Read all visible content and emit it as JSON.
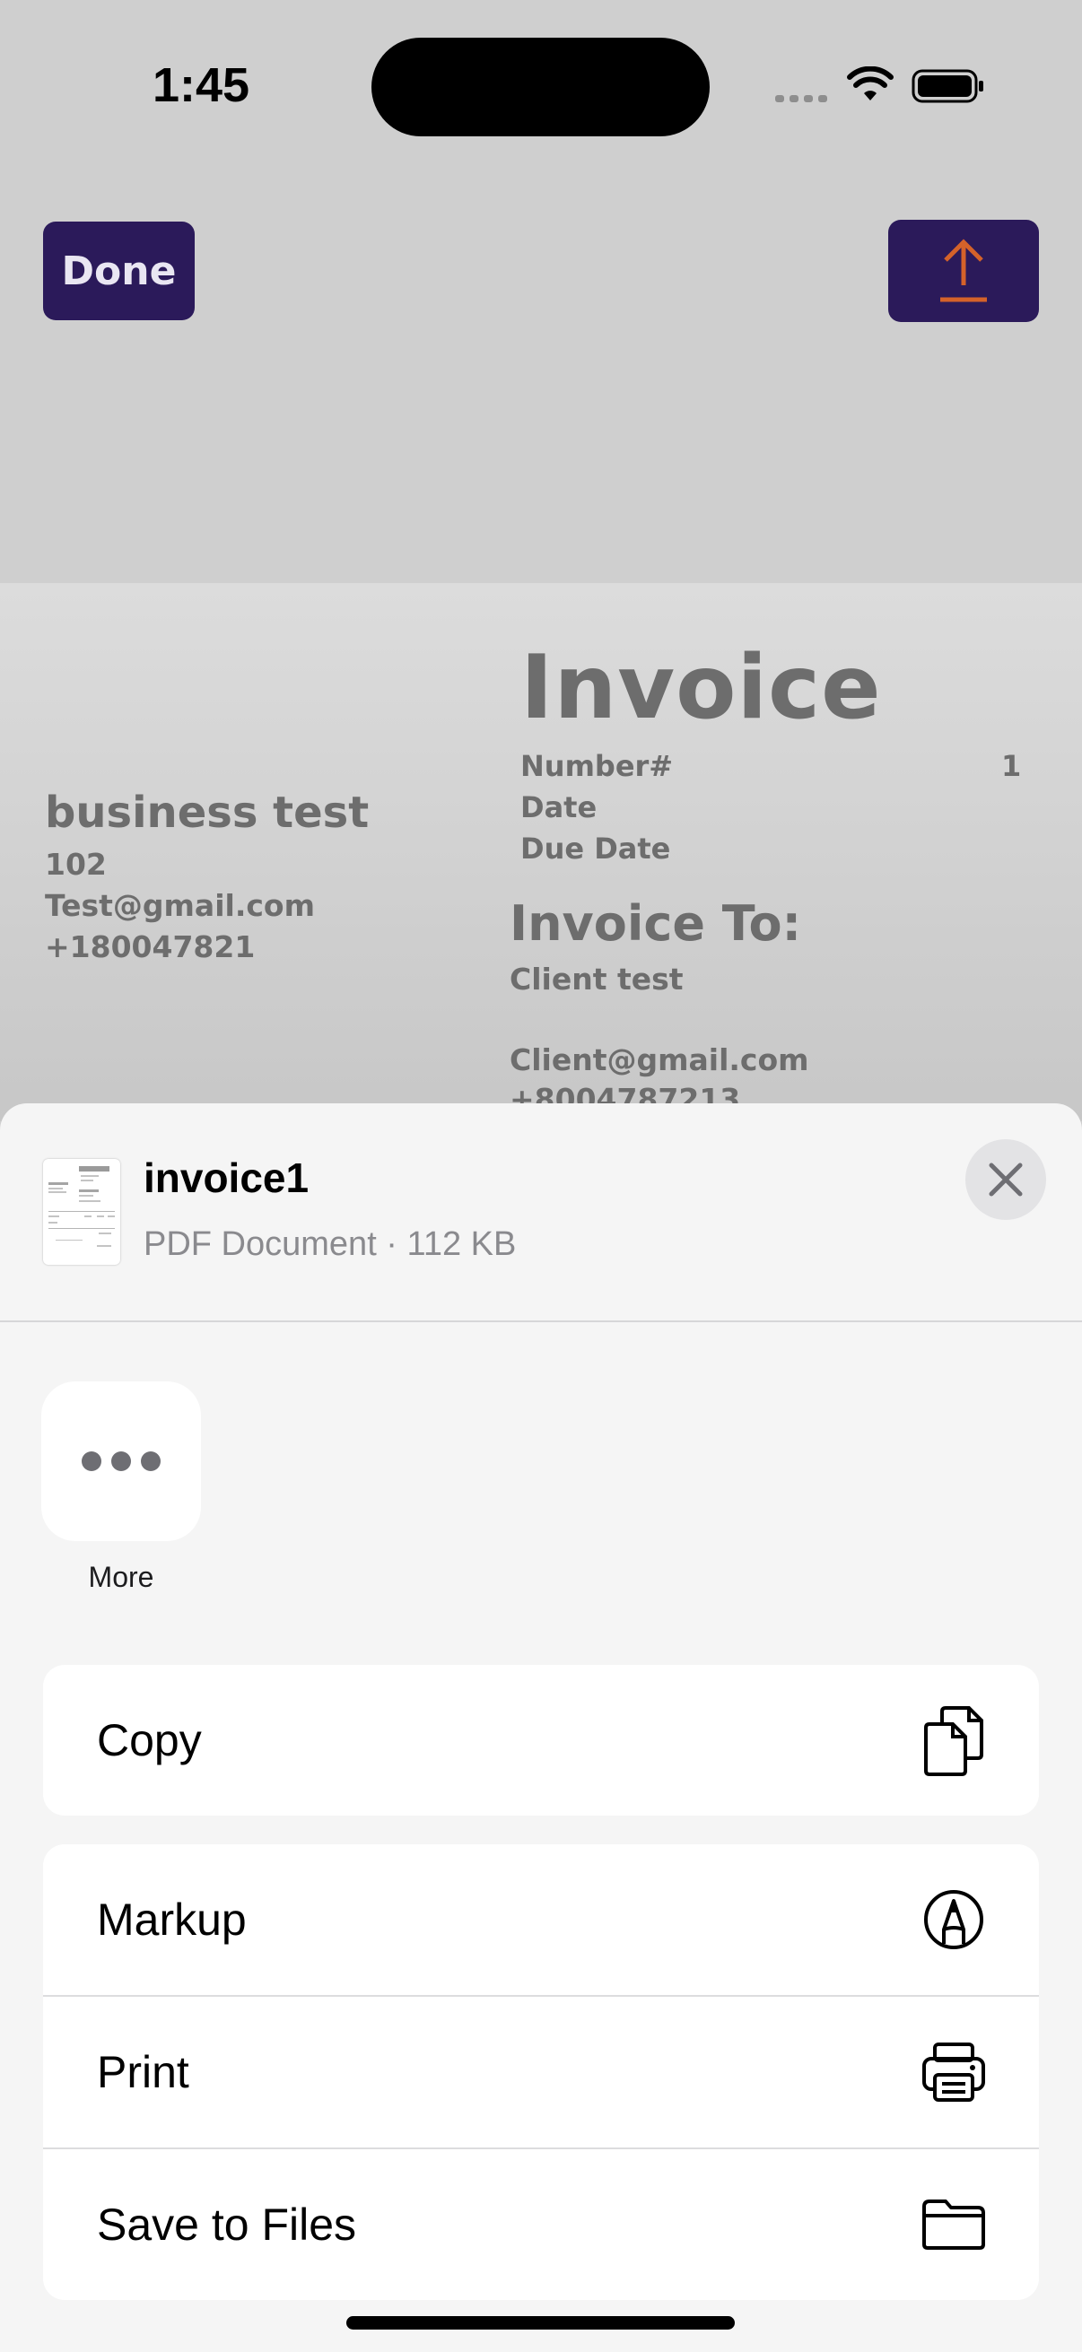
{
  "status_bar": {
    "time": "1:45"
  },
  "toolbar": {
    "done_label": "Done",
    "share_icon": "upload-arrow-icon"
  },
  "invoice": {
    "title": "Invoice",
    "number_label": "Number#",
    "number_value": "1",
    "date_label": "Date",
    "due_date_label": "Due Date",
    "business_name": "business test",
    "business_line1": "102",
    "business_email": "Test@gmail.com",
    "business_phone": "+180047821",
    "invoice_to_label": "Invoice To:",
    "client_name": "Client test",
    "client_email": "Client@gmail.com",
    "client_phone": "+8004787213"
  },
  "share_sheet": {
    "file_name": "invoice1",
    "file_info": "PDF Document · 112 KB",
    "more_label": "More",
    "actions": [
      {
        "label": "Copy",
        "icon": "copy-icon"
      },
      {
        "label": "Markup",
        "icon": "markup-icon"
      },
      {
        "label": "Print",
        "icon": "printer-icon"
      },
      {
        "label": "Save to Files",
        "icon": "folder-icon"
      }
    ]
  },
  "colors": {
    "brand_purple": "#2b1a5a",
    "share_arrow_orange": "#d4622a",
    "sheet_background": "#f5f5f5"
  }
}
